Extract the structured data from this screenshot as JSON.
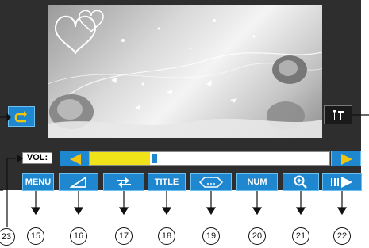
{
  "volume": {
    "label": "VOL:",
    "level_fraction": 0.25,
    "colors": {
      "fill": "#f1e31a",
      "thumb": "#1f86d0",
      "track": "#ffffff"
    }
  },
  "side_buttons": {
    "repeat_icon": "repeat-icon",
    "settings_icon": "settings-tools-icon"
  },
  "controls": [
    {
      "label": "MENU",
      "icon": ""
    },
    {
      "label": "",
      "icon": "volume-ramp-icon"
    },
    {
      "label": "",
      "icon": "repeat-ab-icon"
    },
    {
      "label": "TITLE",
      "icon": ""
    },
    {
      "label": "",
      "icon": "subtitle-dots-icon"
    },
    {
      "label": "NUM",
      "icon": ""
    },
    {
      "label": "",
      "icon": "zoom-in-icon"
    },
    {
      "label": "",
      "icon": "step-play-icon"
    }
  ],
  "callouts": [
    "15",
    "16",
    "17",
    "18",
    "19",
    "20",
    "21",
    "22",
    "23"
  ],
  "colors": {
    "panel": "#2e2e2e",
    "button": "#1f86d0",
    "button_border": "#6cc0f0",
    "arrow_yellow": "#f1c40f"
  }
}
